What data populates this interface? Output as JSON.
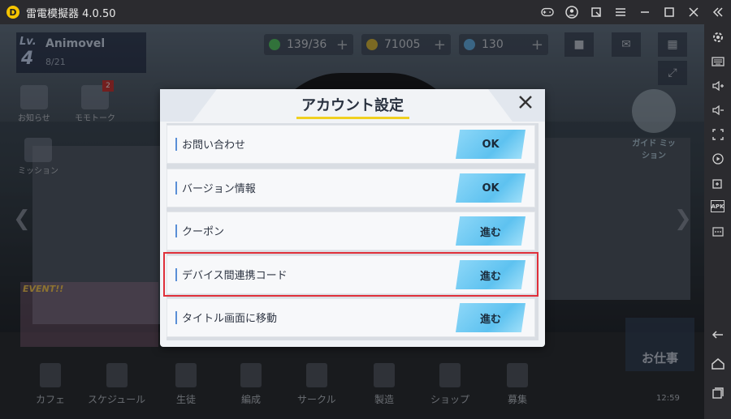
{
  "window": {
    "title": "雷電模擬器 4.0.50",
    "controls": [
      "gamepad-icon",
      "account-icon",
      "screenshot-icon",
      "menu-icon",
      "minimize-icon",
      "maximize-icon",
      "close-icon",
      "collapse-icon"
    ]
  },
  "sidebar": {
    "items": [
      "settings-icon",
      "keyboard-icon",
      "volume-up-icon",
      "volume-down-icon",
      "fullscreen-icon",
      "record-icon",
      "add-app-icon",
      "apk-icon",
      "more-icon",
      "back-icon",
      "home-icon",
      "recent-apps-icon"
    ],
    "apk_label": "APK"
  },
  "hud": {
    "level_label": "Lv.",
    "level": "4",
    "player_name": "Animovel",
    "exp": "8/21",
    "ap": "139/36",
    "credits": "71005",
    "gems": "130",
    "plus": "+"
  },
  "left_menu": [
    {
      "label": "お知らせ"
    },
    {
      "label": "モモトーク",
      "badge": "2"
    },
    {
      "label": "ミッション"
    }
  ],
  "event_label": "EVENT!!",
  "guide_label": "ガイド ミッション",
  "work_label": "お仕事",
  "clock": "12:59",
  "bottom_nav": [
    {
      "label": "カフェ"
    },
    {
      "label": "スケジュール"
    },
    {
      "label": "生徒"
    },
    {
      "label": "編成"
    },
    {
      "label": "サークル"
    },
    {
      "label": "製造"
    },
    {
      "label": "ショップ"
    },
    {
      "label": "募集"
    }
  ],
  "dialog": {
    "title": "アカウント設定",
    "rows": [
      {
        "label": "お問い合わせ",
        "button": "OK"
      },
      {
        "label": "バージョン情報",
        "button": "OK"
      },
      {
        "label": "クーポン",
        "button": "進む"
      },
      {
        "label": "デバイス間連携コード",
        "button": "進む"
      },
      {
        "label": "タイトル画面に移動",
        "button": "進む"
      }
    ]
  },
  "colors": {
    "highlight": "#e0303a",
    "button": "#5ec2f0",
    "title_underline": "#f0d020"
  }
}
